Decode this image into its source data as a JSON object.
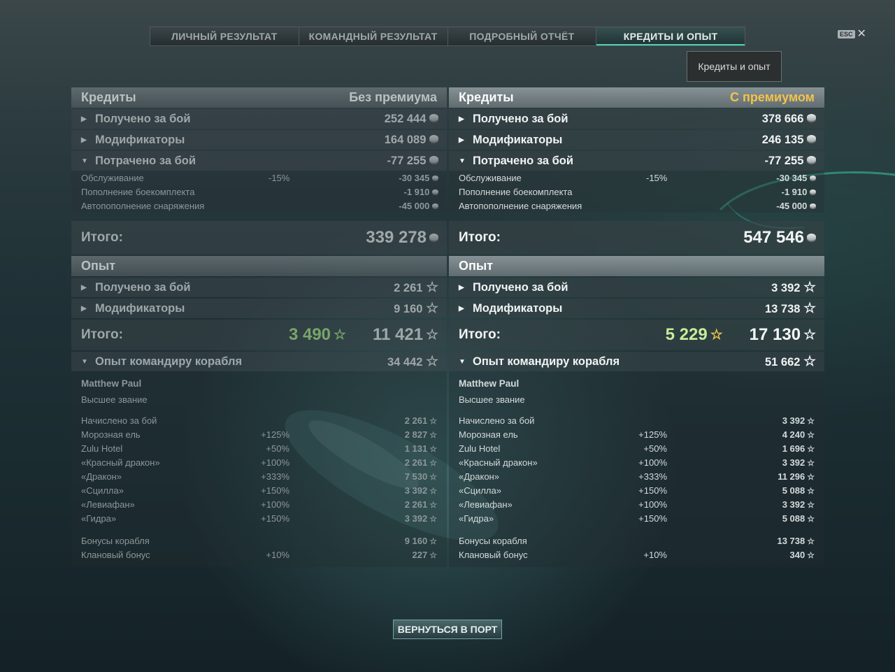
{
  "tabs": [
    "ЛИЧНЫЙ РЕЗУЛЬТАТ",
    "КОМАНДНЫЙ РЕЗУЛЬТАТ",
    "ПОДРОБНЫЙ ОТЧЁТ",
    "КРЕДИТЫ И ОПЫТ"
  ],
  "active_tab": "КРЕДИТЫ И ОПЫТ",
  "esc_label": "ESC",
  "tooltip": "Кредиты и опыт",
  "return_button": "ВЕРНУТЬСЯ В ПОРТ",
  "left": {
    "credits": {
      "title": "Кредиты",
      "mode": "Без премиума",
      "earned_label": "Получено за бой",
      "earned": "252 444",
      "modifiers_label": "Модификаторы",
      "modifiers": "164 089",
      "spent_label": "Потрачено за бой",
      "spent": "-77 255",
      "service_label": "Обслуживание",
      "service_pct": "-15%",
      "service": "-30 345",
      "ammo_label": "Пополнение боекомплекта",
      "ammo": "-1 910",
      "auto_label": "Автопополнение снаряжения",
      "auto": "-45 000",
      "total_label": "Итого:",
      "total": "339 278"
    },
    "xp": {
      "title": "Опыт",
      "earned_label": "Получено за бой",
      "earned": "2 261",
      "modifiers_label": "Модификаторы",
      "modifiers": "9 160",
      "total_label": "Итого:",
      "free": "3 490",
      "total": "11 421",
      "cmd_label": "Опыт командиру корабля",
      "cmd": "34 442"
    },
    "commander": {
      "name": "Matthew Paul",
      "rank": "Высшее звание",
      "accrued_label": "Начислено за бой",
      "accrued": "2 261",
      "items": [
        {
          "label": "Морозная ель",
          "pct": "+125%",
          "val": "2 827"
        },
        {
          "label": "Zulu Hotel",
          "pct": "+50%",
          "val": "1 131"
        },
        {
          "label": "«Красный дракон»",
          "pct": "+100%",
          "val": "2 261"
        },
        {
          "label": "«Дракон»",
          "pct": "+333%",
          "val": "7 530"
        },
        {
          "label": "«Сцилла»",
          "pct": "+150%",
          "val": "3 392"
        },
        {
          "label": "«Левиафан»",
          "pct": "+100%",
          "val": "2 261"
        },
        {
          "label": "«Гидра»",
          "pct": "+150%",
          "val": "3 392"
        }
      ],
      "ship_bonus_label": "Бонусы корабля",
      "ship_bonus": "9 160",
      "clan_bonus_label": "Клановый бонус",
      "clan_bonus_pct": "+10%",
      "clan_bonus": "227"
    }
  },
  "right": {
    "credits": {
      "title": "Кредиты",
      "mode": "С премиумом",
      "earned_label": "Получено за бой",
      "earned": "378 666",
      "modifiers_label": "Модификаторы",
      "modifiers": "246 135",
      "spent_label": "Потрачено за бой",
      "spent": "-77 255",
      "service_label": "Обслуживание",
      "service_pct": "-15%",
      "service": "-30 345",
      "ammo_label": "Пополнение боекомплекта",
      "ammo": "-1 910",
      "auto_label": "Автопополнение снаряжения",
      "auto": "-45 000",
      "total_label": "Итого:",
      "total": "547 546"
    },
    "xp": {
      "title": "Опыт",
      "earned_label": "Получено за бой",
      "earned": "3 392",
      "modifiers_label": "Модификаторы",
      "modifiers": "13 738",
      "total_label": "Итого:",
      "free": "5 229",
      "total": "17 130",
      "cmd_label": "Опыт командиру корабля",
      "cmd": "51 662"
    },
    "commander": {
      "name": "Matthew Paul",
      "rank": "Высшее звание",
      "accrued_label": "Начислено за бой",
      "accrued": "3 392",
      "items": [
        {
          "label": "Морозная ель",
          "pct": "+125%",
          "val": "4 240"
        },
        {
          "label": "Zulu Hotel",
          "pct": "+50%",
          "val": "1 696"
        },
        {
          "label": "«Красный дракон»",
          "pct": "+100%",
          "val": "3 392"
        },
        {
          "label": "«Дракон»",
          "pct": "+333%",
          "val": "11 296"
        },
        {
          "label": "«Сцилла»",
          "pct": "+150%",
          "val": "5 088"
        },
        {
          "label": "«Левиафан»",
          "pct": "+100%",
          "val": "3 392"
        },
        {
          "label": "«Гидра»",
          "pct": "+150%",
          "val": "5 088"
        }
      ],
      "ship_bonus_label": "Бонусы корабля",
      "ship_bonus": "13 738",
      "clan_bonus_label": "Клановый бонус",
      "clan_bonus_pct": "+10%",
      "clan_bonus": "340"
    }
  }
}
